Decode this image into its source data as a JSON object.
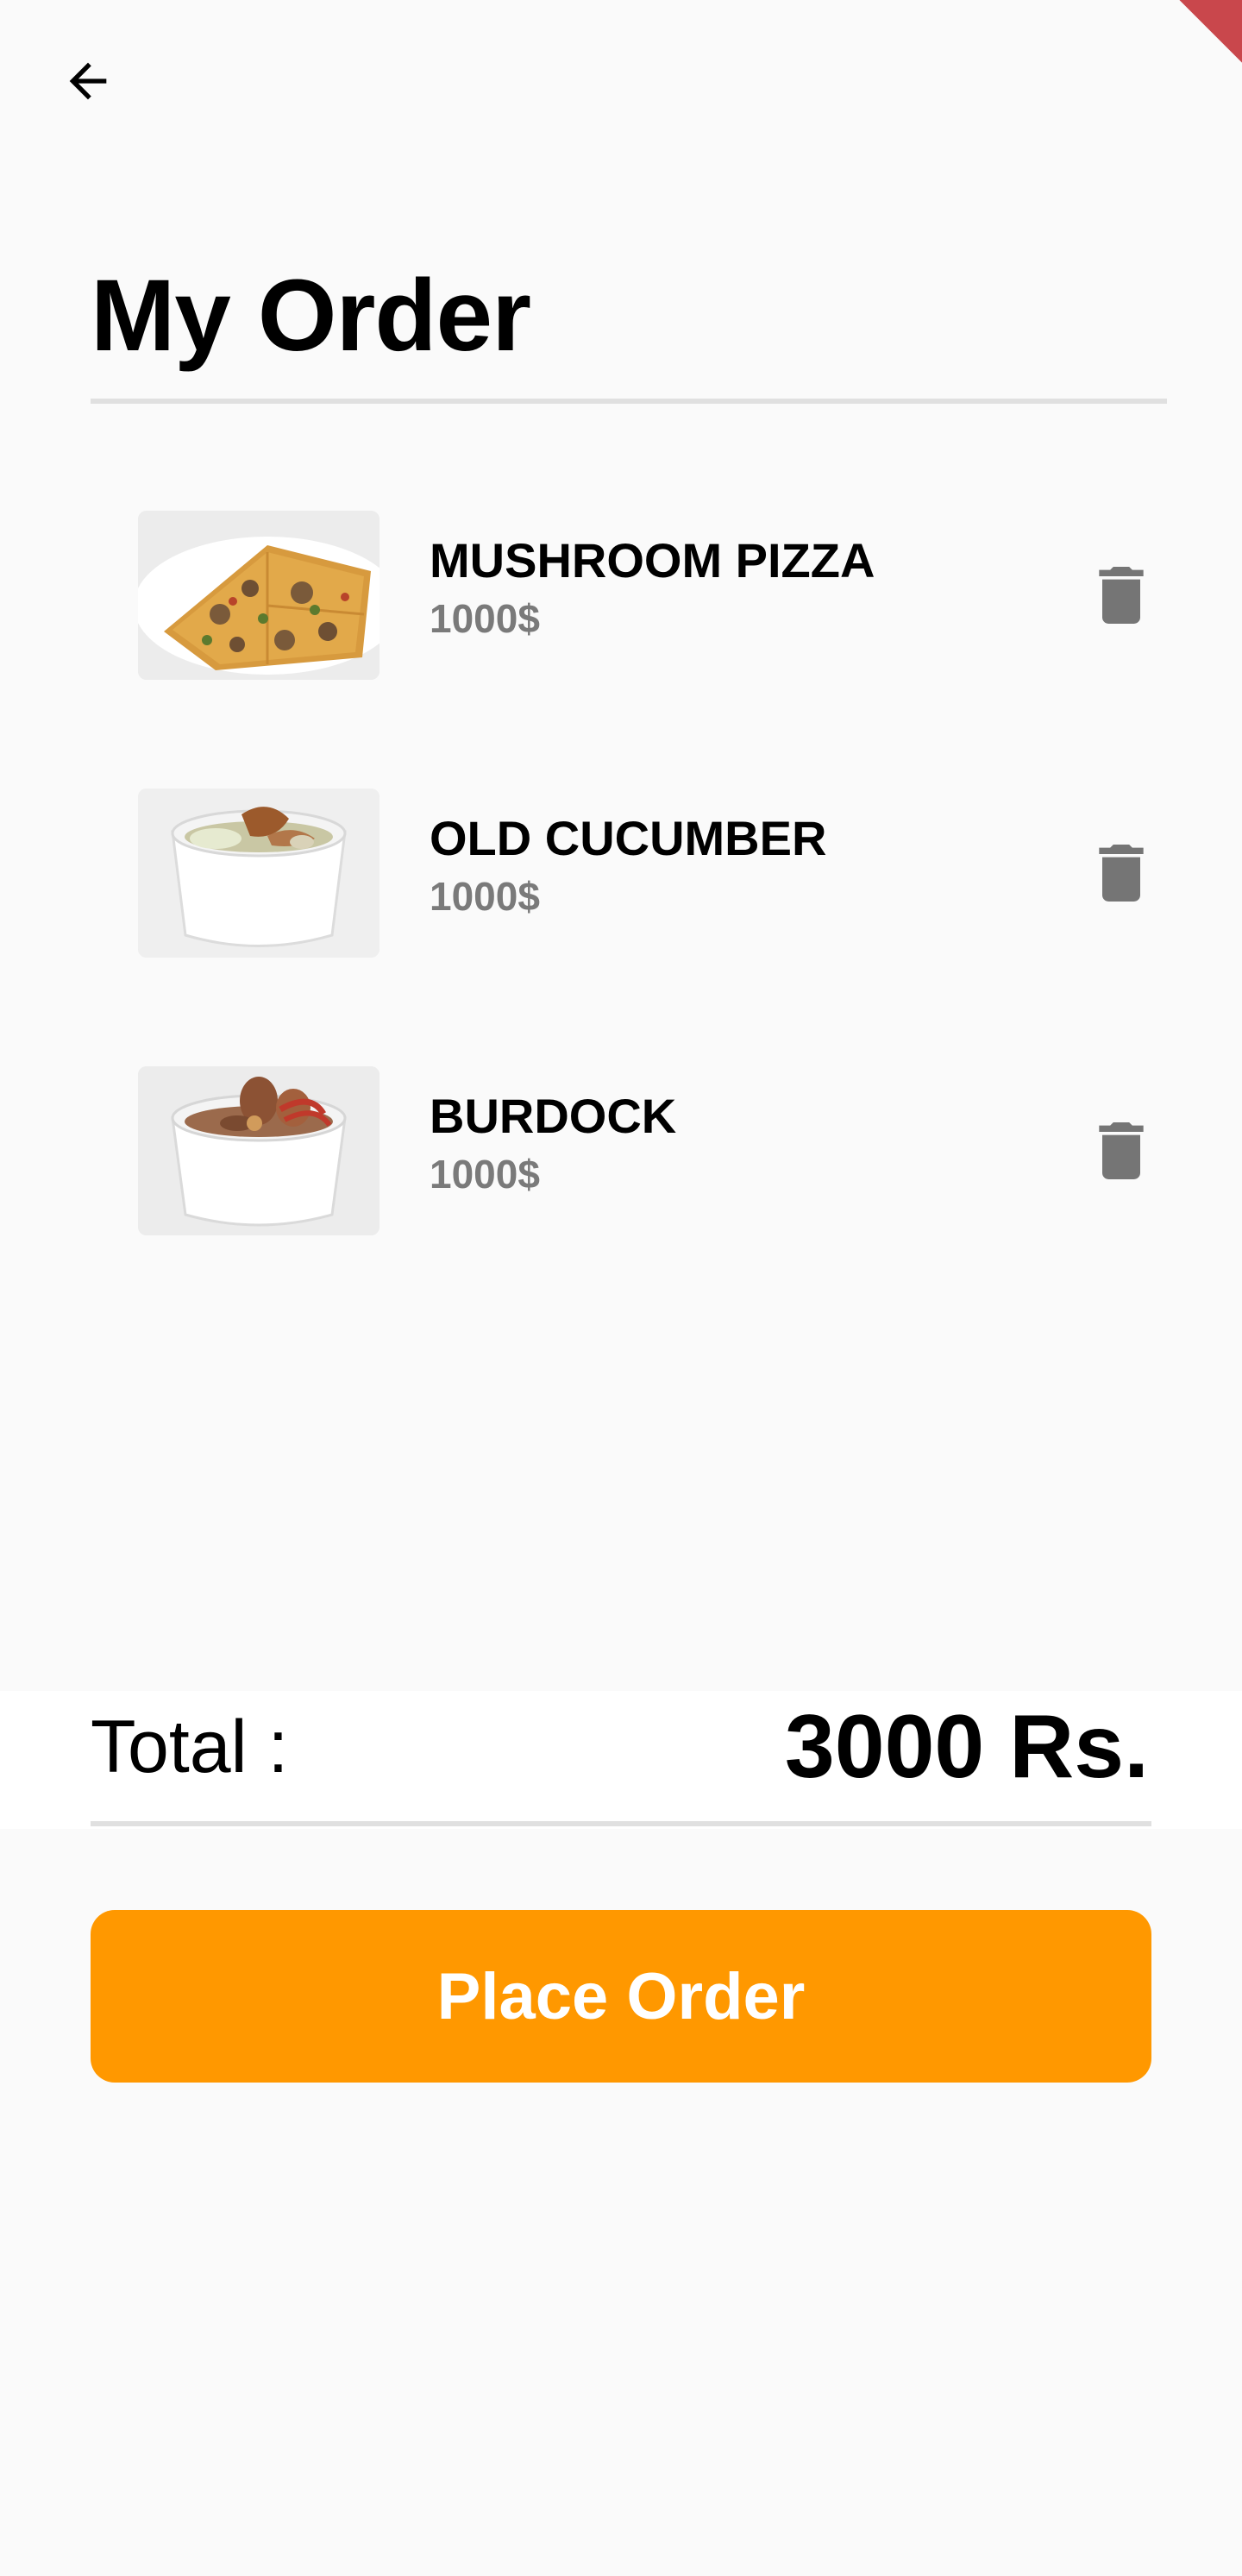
{
  "header": {
    "back_icon": "arrow-left-icon",
    "title": "My Order"
  },
  "order": {
    "items": [
      {
        "name": "MUSHROOM PIZZA",
        "price": "1000$",
        "image": "mushroom-pizza-photo",
        "delete_icon": "trash-icon"
      },
      {
        "name": "OLD CUCUMBER",
        "price": "1000$",
        "image": "cucumber-soup-photo",
        "delete_icon": "trash-icon"
      },
      {
        "name": "BURDOCK",
        "price": "1000$",
        "image": "burdock-soup-photo",
        "delete_icon": "trash-icon"
      }
    ]
  },
  "summary": {
    "total_label": "Total :",
    "total_value": "3000 Rs."
  },
  "actions": {
    "place_order_label": "Place Order"
  },
  "colors": {
    "background": "#fafafa",
    "accent": "#ff9800",
    "price_text": "#7a7a7a",
    "icon_gray": "#757575",
    "divider": "#e0e0e0",
    "debug_ribbon": "#c9474c"
  }
}
